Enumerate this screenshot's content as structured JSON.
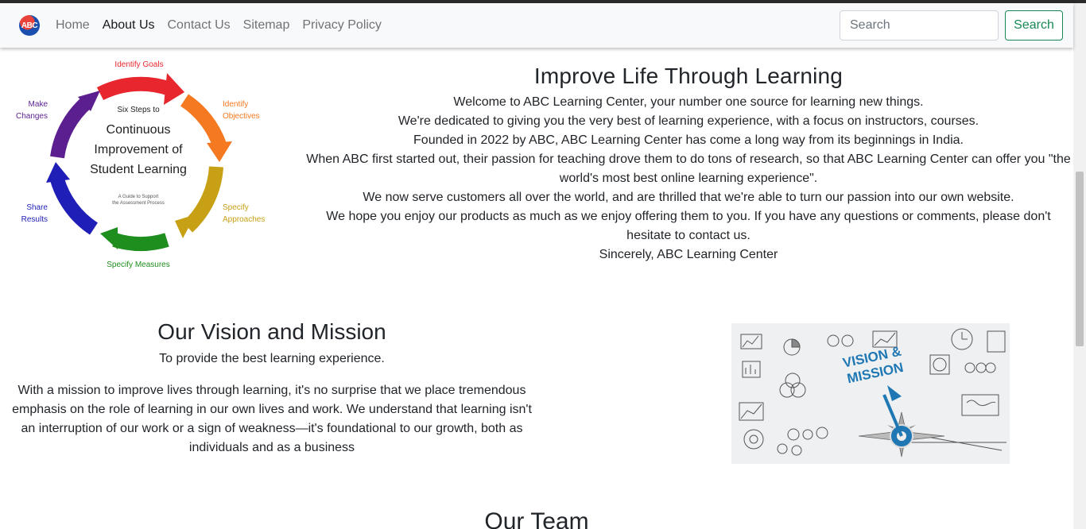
{
  "nav": {
    "logo_text": "ABC",
    "links": [
      "Home",
      "About Us",
      "Contact Us",
      "Sitemap",
      "Privacy Policy"
    ],
    "active": "About Us",
    "search_placeholder": "Search",
    "search_button": "Search"
  },
  "cycle_diagram": {
    "center_small": "Six Steps to",
    "center_title_lines": [
      "Continuous",
      "Improvement of",
      "Student Learning"
    ],
    "center_sub_lines": [
      "A Guide to Support",
      "the Assessment Process"
    ],
    "steps": [
      {
        "label": "Identify Goals",
        "color": "#e8262e"
      },
      {
        "label_lines": [
          "Identify",
          "Objectives"
        ],
        "color": "#f47920"
      },
      {
        "label_lines": [
          "Specify",
          "Approaches"
        ],
        "color": "#c8a016"
      },
      {
        "label": "Specify Measures",
        "color": "#1e8e1e"
      },
      {
        "label_lines": [
          "Share",
          "Results"
        ],
        "color": "#1f1fb8"
      },
      {
        "label_lines": [
          "Make",
          "Changes"
        ],
        "color": "#5b1f8f"
      }
    ]
  },
  "about": {
    "title": "Improve Life Through Learning",
    "lines": [
      "Welcome to ABC Learning Center, your number one source for learning new things.",
      "We're dedicated to giving you the very best of learning experience, with a focus on instructors, courses.",
      "Founded in 2022 by ABC, ABC Learning Center has come a long way from its beginnings in India.",
      "When ABC first started out, their passion for teaching drove them to do tons of research, so that ABC Learning Center can offer you \"the world's most best online learning experience\".",
      "We now serve customers all over the world, and are thrilled that we're able to turn our passion into our own website.",
      "We hope you enjoy our products as much as we enjoy offering them to you. If you have any questions or comments, please don't hesitate to contact us.",
      "Sincerely, ABC Learning Center"
    ]
  },
  "vision": {
    "title": "Our Vision and Mission",
    "tagline": "To provide the best learning experience.",
    "mission": "With a mission to improve lives through learning, it's no surprise that we place tremendous emphasis on the role of learning in our own lives and work. We understand that learning isn't an interruption of our work or a sign of weakness—it's foundational to our growth, both as individuals and as a business",
    "image_text_lines": [
      "VISION &",
      "MISSION"
    ]
  },
  "team": {
    "title": "Our Team"
  },
  "colors": {
    "accent_green": "#198754",
    "navbar_bg": "#f8f9fa"
  }
}
